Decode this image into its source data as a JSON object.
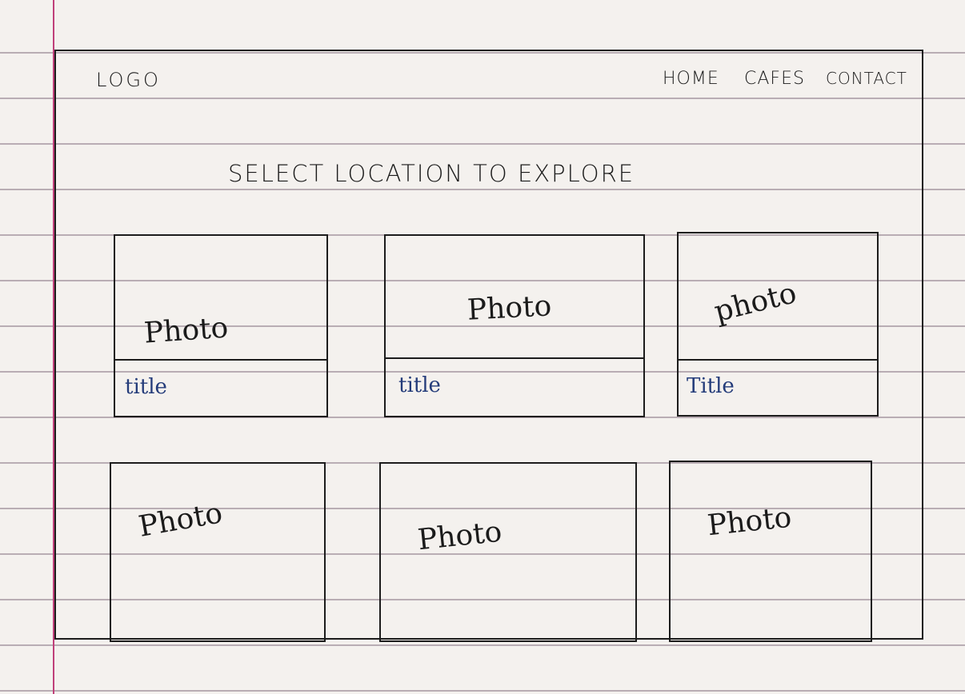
{
  "header": {
    "logo": "LOGO",
    "nav": [
      "HOME",
      "CAFES",
      "CONTACT"
    ]
  },
  "headline": "SELECT LOCATION TO EXPLORE",
  "cards_row1": [
    {
      "photo": "Photo",
      "title": "title"
    },
    {
      "photo": "Photo",
      "title": "title"
    },
    {
      "photo": "photo",
      "title": "Title"
    }
  ],
  "cards_row2": [
    {
      "photo": "Photo"
    },
    {
      "photo": "Photo"
    },
    {
      "photo": "Photo"
    }
  ],
  "colors": {
    "ink": "#1c1c1c",
    "title_ink": "#243c7a",
    "margin_line": "#c0407a",
    "ruled_line": "#b9adb4"
  }
}
